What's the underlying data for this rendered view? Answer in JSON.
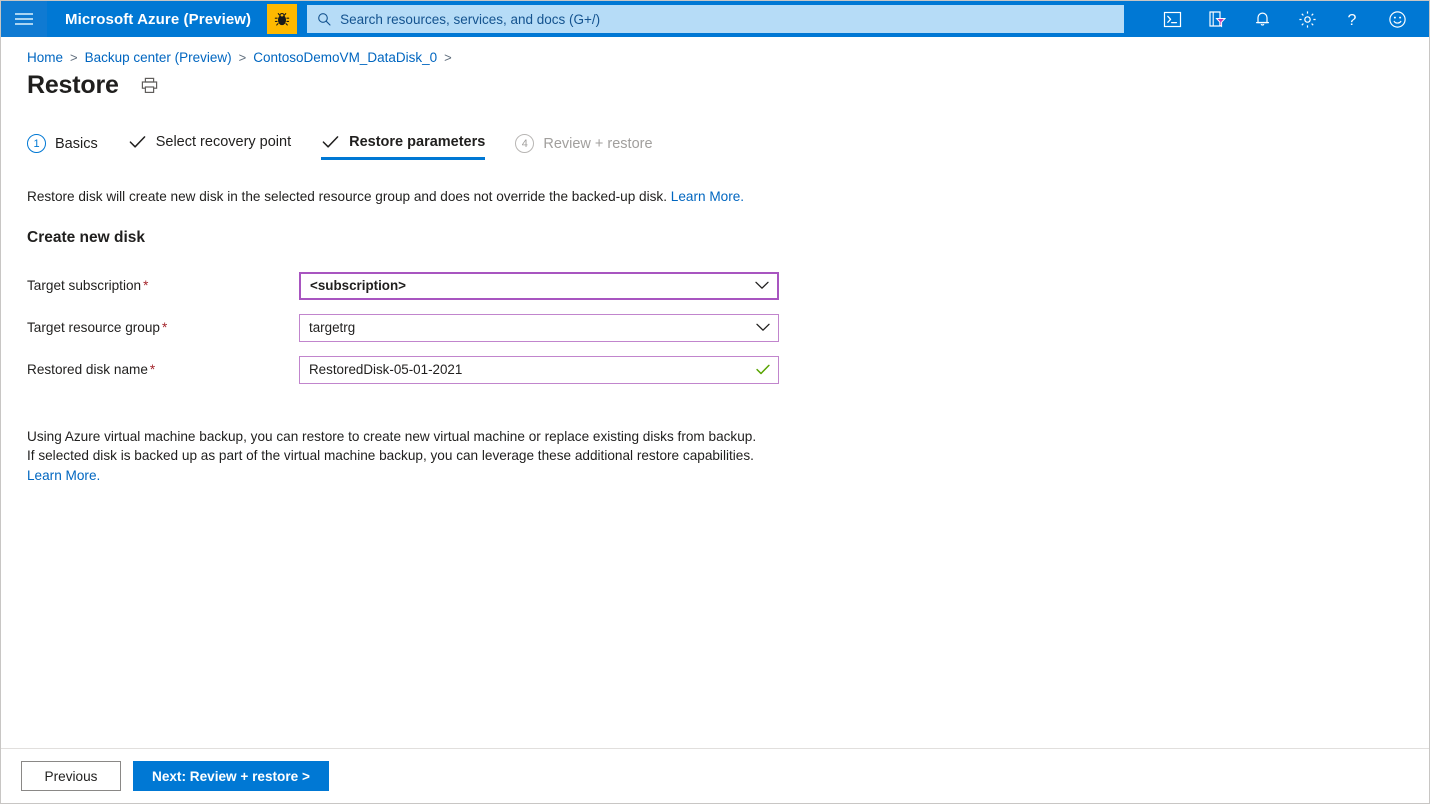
{
  "topbar": {
    "menu_icon": "hamburger-icon",
    "brand": "Microsoft Azure (Preview)",
    "bug_icon": "bug-icon",
    "search": {
      "icon": "search-icon",
      "placeholder": "Search resources, services, and docs (G+/)",
      "value": ""
    },
    "icons": [
      {
        "name": "cloud-shell-icon",
        "title": "Cloud Shell"
      },
      {
        "name": "directory-filter-icon",
        "title": "Directories + subscriptions"
      },
      {
        "name": "notifications-bell-icon",
        "title": "Notifications"
      },
      {
        "name": "settings-gear-icon",
        "title": "Settings"
      },
      {
        "name": "help-question-icon",
        "title": "Help"
      },
      {
        "name": "feedback-smiley-icon",
        "title": "Feedback"
      }
    ]
  },
  "breadcrumb": {
    "items": [
      "Home",
      "Backup center (Preview)",
      "ContosoDemoVM_DataDisk_0"
    ],
    "separator": ">"
  },
  "page": {
    "title": "Restore",
    "print_icon": "printer-icon"
  },
  "wizard": {
    "steps": [
      {
        "label": "Basics",
        "marker": "1",
        "state": "done-number"
      },
      {
        "label": "Select recovery point",
        "marker": "check",
        "state": "done"
      },
      {
        "label": "Restore parameters",
        "marker": "check",
        "state": "current"
      },
      {
        "label": "Review + restore",
        "marker": "4",
        "state": "todo"
      }
    ]
  },
  "main": {
    "intro_text": "Restore disk will create new disk in the selected resource group and does not override the backed-up disk. ",
    "intro_link": "Learn More.",
    "section_title": "Create new disk",
    "fields": [
      {
        "label": "Target subscription",
        "required": "*",
        "value": "<subscription>",
        "control": "dropdown",
        "focused": true,
        "indicator": "chevron-down-icon"
      },
      {
        "label": "Target resource group",
        "required": "*",
        "value": "targetrg",
        "control": "dropdown",
        "focused": false,
        "indicator": "chevron-down-icon"
      },
      {
        "label": "Restored disk name",
        "required": "*",
        "value": "RestoredDisk-05-01-2021",
        "control": "textbox",
        "focused": false,
        "indicator": "valid-check-icon"
      }
    ],
    "note_text": "Using Azure virtual machine backup, you can restore to create new virtual machine or replace existing disks from backup. If selected disk is backed up as part of the virtual machine backup, you can leverage these additional restore capabilities. ",
    "note_link": "Learn More."
  },
  "footer": {
    "previous_label": "Previous",
    "next_label": "Next: Review + restore >"
  },
  "colors": {
    "azure_blue": "#0078d4",
    "link_blue": "#0066c0",
    "required_red": "#a4262c",
    "field_purple": "#c185cd",
    "field_purple_focus": "#a855c0",
    "valid_green": "#57a300",
    "preview_yellow": "#ffb900"
  }
}
